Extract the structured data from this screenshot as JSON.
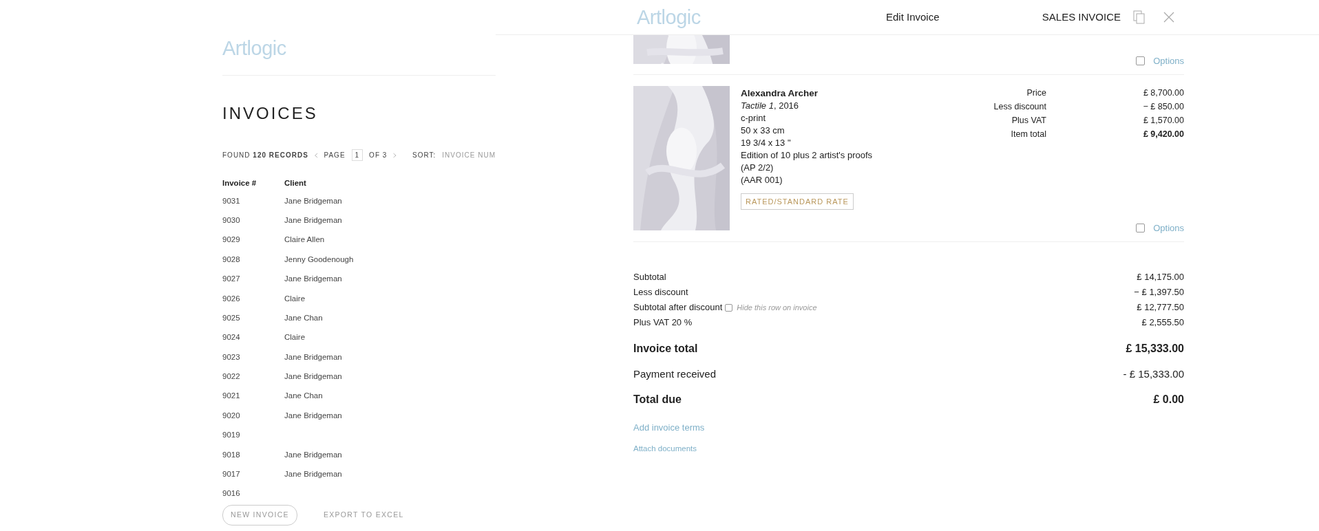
{
  "list_page": {
    "logo": "Artlogic",
    "title": "INVOICES",
    "toolbar": {
      "found": "FOUND **120 RECORDS**",
      "page_label": "PAGE",
      "page_value": "1",
      "page_of": "OF 3",
      "sort_label": "SORT:",
      "sort_value": "INVOICE NUM"
    },
    "table": {
      "columns": [
        "Invoice #",
        "Client"
      ],
      "rows": [
        {
          "invoice": "9031",
          "client": "Jane Bridgeman"
        },
        {
          "invoice": "9030",
          "client": "Jane Bridgeman"
        },
        {
          "invoice": "9029",
          "client": "Claire Allen"
        },
        {
          "invoice": "9028",
          "client": "Jenny Goodenough"
        },
        {
          "invoice": "9027",
          "client": "Jane Bridgeman"
        },
        {
          "invoice": "9026",
          "client": "Claire"
        },
        {
          "invoice": "9025",
          "client": "Jane Chan"
        },
        {
          "invoice": "9024",
          "client": "Claire"
        },
        {
          "invoice": "9023",
          "client": "Jane Bridgeman"
        },
        {
          "invoice": "9022",
          "client": "Jane Bridgeman"
        },
        {
          "invoice": "9021",
          "client": "Jane Chan"
        },
        {
          "invoice": "9020",
          "client": "Jane Bridgeman"
        },
        {
          "invoice": "9019"
        },
        {
          "invoice": "9018",
          "client": "Jane Bridgeman"
        },
        {
          "invoice": "9017",
          "client": "Jane Bridgeman"
        },
        {
          "invoice": "9016"
        }
      ]
    },
    "buttons": [
      {
        "kind": "outline",
        "label": "NEW INVOICE"
      },
      {
        "kind": "plain",
        "label": "EXPORT TO EXCEL"
      }
    ]
  },
  "panel": {
    "logo": "Artlogic",
    "title": "Edit Invoice",
    "doc_type": "SALES INVOICE",
    "items": [
      {
        "kind": "partial",
        "options_label": "Options",
        "checked": false
      },
      {
        "kind": "full",
        "artist": "Alexandra Archer",
        "title": "*Tactile 1*, 2016",
        "details": [
          "c-print",
          "50 x 33 cm",
          "19 3/4 x 13 \"",
          "Edition of 10 plus 2 artist's proofs",
          "(AP 2/2)",
          "(AAR 001)"
        ],
        "tax_tag": "RATED/STANDARD RATE",
        "prices": [
          {
            "label": "Price",
            "value": "£ 8,700.00",
            "bold": false
          },
          {
            "label": "Less discount",
            "value": "− £ 850.00",
            "bold": false
          },
          {
            "label": "Plus VAT",
            "value": "£ 1,570.00",
            "bold": false
          },
          {
            "label": "Item total",
            "value": "£ 9,420.00",
            "bold": true
          }
        ],
        "options_label": "Options",
        "checked": false
      }
    ],
    "totals": [
      {
        "kind": "small",
        "label": "Subtotal",
        "value": "£ 14,175.00"
      },
      {
        "kind": "small",
        "label": "Less discount",
        "value": "− £ 1,397.50"
      },
      {
        "kind": "small",
        "label": "Subtotal after discount",
        "value": "£ 12,777.50",
        "hide_option": {
          "label": "Hide this row on invoice",
          "checked": false
        }
      },
      {
        "kind": "small",
        "label": "Plus VAT 20 %",
        "value": "£ 2,555.50"
      },
      {
        "kind": "bold",
        "label": "Invoice total",
        "value": "£ 15,333.00"
      },
      {
        "kind": "medium",
        "label": "Payment received",
        "value": "- £ 15,333.00"
      },
      {
        "kind": "bold",
        "label": "Total due",
        "value": "£ 0.00"
      }
    ],
    "links": [
      "Add invoice terms",
      "Attach documents"
    ]
  }
}
